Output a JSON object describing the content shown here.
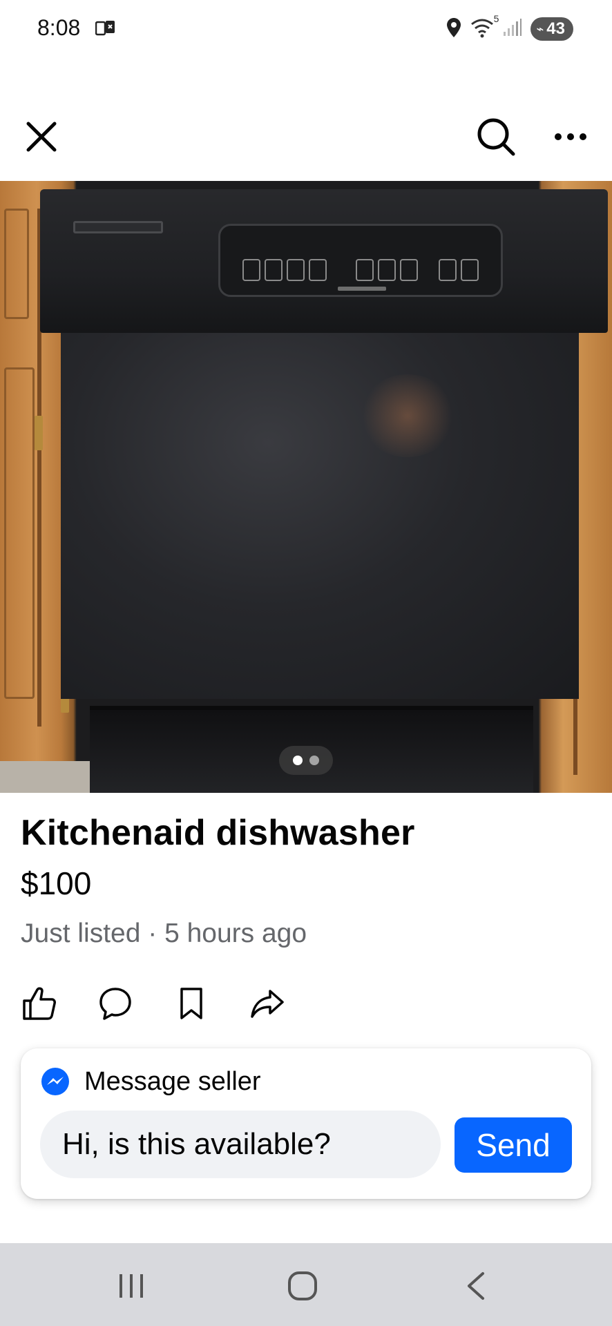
{
  "status_bar": {
    "time": "8:08",
    "battery": "43",
    "wifi_label": "5"
  },
  "listing": {
    "title": "Kitchenaid dishwasher",
    "price": "$100",
    "meta": "Just listed · 5 hours ago",
    "photo_index": 1,
    "photo_count": 2
  },
  "message": {
    "header_label": "Message seller",
    "input_value": "Hi, is this available?",
    "send_label": "Send"
  },
  "icons": {
    "close": "close-icon",
    "search": "search-icon",
    "more": "more-icon",
    "like": "like-icon",
    "comment": "comment-icon",
    "save": "bookmark-icon",
    "share": "share-icon",
    "messenger": "messenger-icon"
  },
  "colors": {
    "accent": "#0866ff",
    "secondary_text": "#65676b",
    "input_bg": "#f0f2f5",
    "nav_bar_bg": "#d8d9dd"
  }
}
